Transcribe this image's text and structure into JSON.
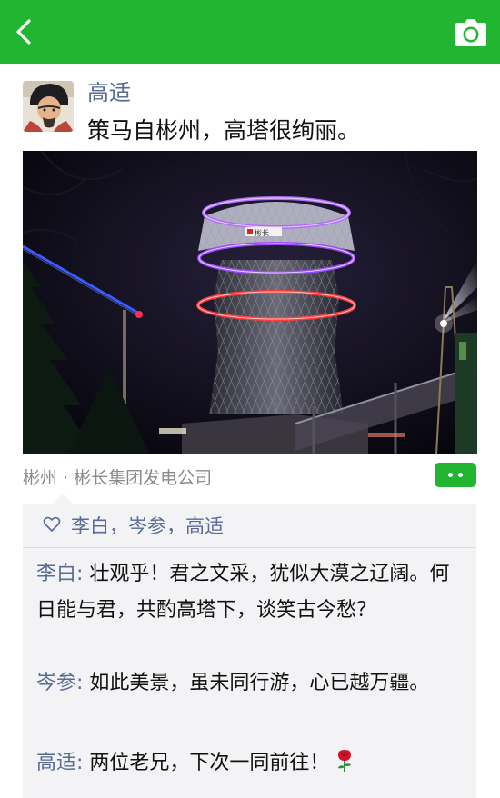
{
  "topbar": {
    "bg_color": "#21b531",
    "back_icon": "chevron-left-icon",
    "camera_icon": "camera-icon"
  },
  "post": {
    "author": "高适",
    "text": "策马自彬州，高塔很绚丽。",
    "location": "彬州 · 彬长集团发电公司",
    "photo_sign": "彬长"
  },
  "likes": {
    "icon": "heart-icon",
    "names": "李白，岑参，高适"
  },
  "comments": [
    {
      "author": "李白",
      "sep": ": ",
      "text": "壮观乎！君之文采，犹似大漠之辽阔。何日能与君，共酌高塔下，谈笑古今愁？"
    },
    {
      "author": "岑参",
      "sep": ": ",
      "text": "如此美景，虽未同行游，心已越万疆。"
    },
    {
      "author": "高适",
      "sep": ": ",
      "text": "两位老兄，下次一同前往！",
      "emoji": "rose-icon"
    }
  ],
  "colors": {
    "link": "#576b95",
    "accent": "#21b531",
    "comments_bg": "#f3f3f5"
  }
}
